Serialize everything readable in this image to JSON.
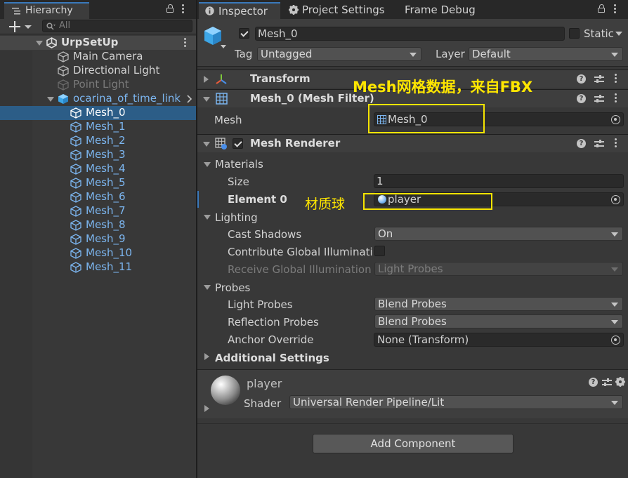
{
  "hierarchy": {
    "tab_label": "Hierarchy",
    "search_placeholder": "All",
    "scene_name": "UrpSetUp",
    "items": [
      {
        "label": "Main Camera"
      },
      {
        "label": "Directional Light"
      },
      {
        "label": "Point Light"
      },
      {
        "label": "ocarina_of_time_link"
      },
      {
        "label": "Mesh_0"
      },
      {
        "label": "Mesh_1"
      },
      {
        "label": "Mesh_2"
      },
      {
        "label": "Mesh_3"
      },
      {
        "label": "Mesh_4"
      },
      {
        "label": "Mesh_5"
      },
      {
        "label": "Mesh_6"
      },
      {
        "label": "Mesh_7"
      },
      {
        "label": "Mesh_8"
      },
      {
        "label": "Mesh_9"
      },
      {
        "label": "Mesh_10"
      },
      {
        "label": "Mesh_11"
      }
    ]
  },
  "inspector": {
    "tabs": [
      "Inspector",
      "Project Settings",
      "Frame Debug"
    ],
    "object_name": "Mesh_0",
    "static_label": "Static",
    "tag_label": "Tag",
    "tag_value": "Untagged",
    "layer_label": "Layer",
    "layer_value": "Default",
    "transform_title": "Transform",
    "mesh_filter_title": "Mesh_0 (Mesh Filter)",
    "mesh_label": "Mesh",
    "mesh_value": "Mesh_0",
    "mesh_renderer_title": "Mesh Renderer",
    "materials_label": "Materials",
    "size_label": "Size",
    "size_value": "1",
    "element0_label": "Element 0",
    "element0_value": "player",
    "lighting_label": "Lighting",
    "cast_shadows_label": "Cast Shadows",
    "cast_shadows_value": "On",
    "contribute_gi_label": "Contribute Global Illumination",
    "receive_gi_label": "Receive Global Illumination",
    "receive_gi_value": "Light Probes",
    "probes_label": "Probes",
    "light_probes_label": "Light Probes",
    "light_probes_value": "Blend Probes",
    "reflection_probes_label": "Reflection Probes",
    "reflection_probes_value": "Blend Probes",
    "anchor_override_label": "Anchor Override",
    "anchor_override_value": "None (Transform)",
    "additional_settings_label": "Additional Settings",
    "material_name": "player",
    "shader_label": "Shader",
    "shader_value": "Universal Render Pipeline/Lit",
    "add_component_label": "Add Component"
  },
  "annotations": {
    "mesh_note": "Mesh网格数据，来自FBX",
    "material_note": "材质球"
  },
  "colors": {
    "accent": "#3a79bb",
    "selection": "#2c5d87",
    "annotation": "#ffe600",
    "prefab_blue": "#7cb6f0"
  }
}
